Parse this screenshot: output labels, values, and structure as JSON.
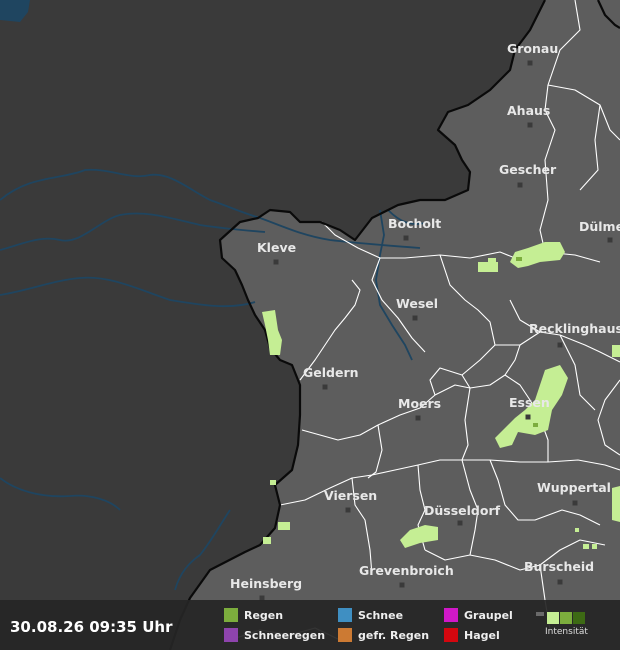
{
  "timestamp": "30.08.26 09:35 Uhr",
  "colors": {
    "regen": "#7cad3d",
    "schneeregen": "#8e44ad",
    "schnee": "#3f8fc2",
    "gefr_regen": "#cc7a33",
    "graupel": "#d018c8",
    "hagel": "#d4070f",
    "rain_light": "#c5ee94",
    "rain_medium": "#7cad3d",
    "rain_strong": "#3d6a14",
    "land_inside": "#5d5d5d",
    "land_outside": "#3a3a3a",
    "water": "#1f4560"
  },
  "legend": {
    "items": [
      {
        "key": "regen",
        "label": "Regen",
        "color": "#7cad3d"
      },
      {
        "key": "schneeregen",
        "label": "Schneeregen",
        "color": "#8e44ad"
      },
      {
        "key": "schnee",
        "label": "Schnee",
        "color": "#3f8fc2"
      },
      {
        "key": "gefr_regen",
        "label": "gefr. Regen",
        "color": "#cc7a33"
      },
      {
        "key": "graupel",
        "label": "Graupel",
        "color": "#d018c8"
      },
      {
        "key": "hagel",
        "label": "Hagel",
        "color": "#d4070f"
      }
    ],
    "intensity_label": "Intensität"
  },
  "cities": [
    {
      "key": "gronau",
      "name": "Gronau"
    },
    {
      "key": "ahaus",
      "name": "Ahaus"
    },
    {
      "key": "gescher",
      "name": "Gescher"
    },
    {
      "key": "bocholt",
      "name": "Bocholt"
    },
    {
      "key": "duelmen",
      "name": "Dülmen"
    },
    {
      "key": "kleve",
      "name": "Kleve"
    },
    {
      "key": "wesel",
      "name": "Wesel"
    },
    {
      "key": "recklinghausen",
      "name": "Recklinghausen"
    },
    {
      "key": "geldern",
      "name": "Geldern"
    },
    {
      "key": "moers",
      "name": "Moers"
    },
    {
      "key": "essen",
      "name": "Essen"
    },
    {
      "key": "viersen",
      "name": "Viersen"
    },
    {
      "key": "duesseldorf",
      "name": "Düsseldorf"
    },
    {
      "key": "wuppertal",
      "name": "Wuppertal"
    },
    {
      "key": "grevenbroich",
      "name": "Grevenbroich"
    },
    {
      "key": "burscheid",
      "name": "Burscheid"
    },
    {
      "key": "heinsberg",
      "name": "Heinsberg"
    }
  ]
}
